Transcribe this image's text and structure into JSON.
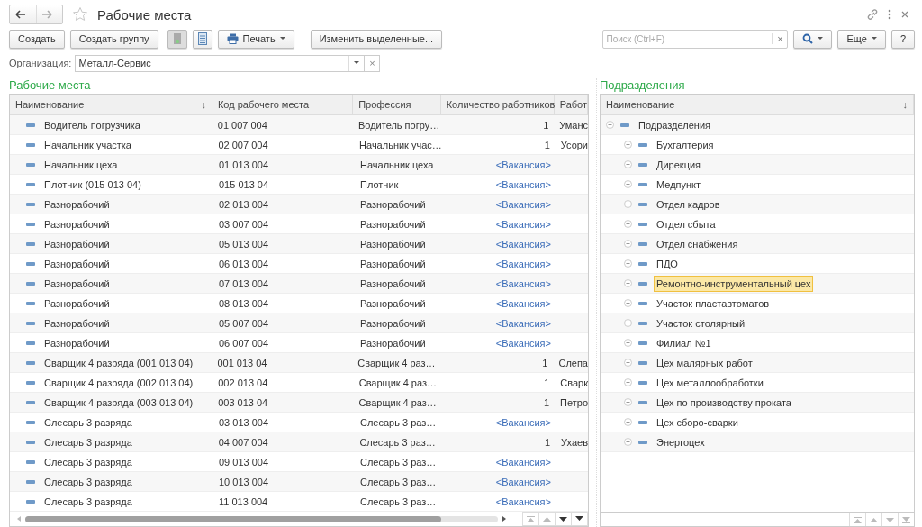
{
  "window": {
    "title": "Рабочие места",
    "favorite": false
  },
  "toolbar": {
    "buttons": [
      {
        "kind": "text",
        "label": "Создать"
      },
      {
        "kind": "text",
        "label": "Создать группу"
      },
      {
        "kind": "copy",
        "disabled": true
      },
      {
        "kind": "list",
        "disabled": false
      },
      {
        "kind": "print",
        "label": "Печать"
      },
      {
        "kind": "text",
        "label": "Изменить выделенные..."
      }
    ],
    "search": {
      "placeholder": "Поиск (Ctrl+F)",
      "clear": "×"
    },
    "more": "Еще",
    "help": "?"
  },
  "organization": {
    "label": "Организация:",
    "value": "Металл-Сервис",
    "clear": "×"
  },
  "workplaces": {
    "title": "Рабочие места",
    "columns": [
      {
        "label": "Наименование",
        "sort": "↓"
      },
      {
        "label": "Код рабочего места"
      },
      {
        "label": "Профессия"
      },
      {
        "label": "Количество работников"
      },
      {
        "label": "Работ"
      }
    ],
    "rows": [
      {
        "name": "Водитель погрузчика",
        "code": "01 007 004",
        "profession": "Водитель погру…",
        "workers": "1",
        "vacancy": false,
        "employee": "Уманс"
      },
      {
        "name": "Начальник участка",
        "code": "02 007 004",
        "profession": "Начальник учас…",
        "workers": "1",
        "vacancy": false,
        "employee": "Усори"
      },
      {
        "name": "Начальник цеха",
        "code": "01 013 004",
        "profession": "Начальник цеха",
        "workers": "<Вакансия>",
        "vacancy": true
      },
      {
        "name": "Плотник (015 013 04)",
        "code": "015 013 04",
        "profession": "Плотник",
        "workers": "<Вакансия>",
        "vacancy": true
      },
      {
        "name": "Разнорабочий",
        "code": "02 013 004",
        "profession": "Разнорабочий",
        "workers": "<Вакансия>",
        "vacancy": true
      },
      {
        "name": "Разнорабочий",
        "code": "03 007 004",
        "profession": "Разнорабочий",
        "workers": "<Вакансия>",
        "vacancy": true
      },
      {
        "name": "Разнорабочий",
        "code": "05 013 004",
        "profession": "Разнорабочий",
        "workers": "<Вакансия>",
        "vacancy": true
      },
      {
        "name": "Разнорабочий",
        "code": "06 013 004",
        "profession": "Разнорабочий",
        "workers": "<Вакансия>",
        "vacancy": true
      },
      {
        "name": "Разнорабочий",
        "code": "07 013 004",
        "profession": "Разнорабочий",
        "workers": "<Вакансия>",
        "vacancy": true
      },
      {
        "name": "Разнорабочий",
        "code": "08 013 004",
        "profession": "Разнорабочий",
        "workers": "<Вакансия>",
        "vacancy": true
      },
      {
        "name": "Разнорабочий",
        "code": "05 007 004",
        "profession": "Разнорабочий",
        "workers": "<Вакансия>",
        "vacancy": true
      },
      {
        "name": "Разнорабочий",
        "code": "06 007 004",
        "profession": "Разнорабочий",
        "workers": "<Вакансия>",
        "vacancy": true
      },
      {
        "name": "Сварщик 4 разряда (001 013 04)",
        "code": "001 013 04",
        "profession": "Сварщик 4 раз…",
        "workers": "1",
        "vacancy": false,
        "employee": "Слепа"
      },
      {
        "name": "Сварщик 4 разряда (002 013 04)",
        "code": "002 013 04",
        "profession": "Сварщик 4 раз…",
        "workers": "1",
        "vacancy": false,
        "employee": "Сварк"
      },
      {
        "name": "Сварщик 4 разряда (003 013 04)",
        "code": "003 013 04",
        "profession": "Сварщик 4 раз…",
        "workers": "1",
        "vacancy": false,
        "employee": "Петро"
      },
      {
        "name": "Слесарь 3 разряда",
        "code": "03 013 004",
        "profession": "Слесарь 3 раз…",
        "workers": "<Вакансия>",
        "vacancy": true
      },
      {
        "name": "Слесарь 3 разряда",
        "code": "04 007 004",
        "profession": "Слесарь 3 раз…",
        "workers": "1",
        "vacancy": false,
        "employee": "Ухаев"
      },
      {
        "name": "Слесарь 3 разряда",
        "code": "09 013 004",
        "profession": "Слесарь 3 раз…",
        "workers": "<Вакансия>",
        "vacancy": true
      },
      {
        "name": "Слесарь 3 разряда",
        "code": "10 013 004",
        "profession": "Слесарь 3 раз…",
        "workers": "<Вакансия>",
        "vacancy": true
      },
      {
        "name": "Слесарь 3 разряда",
        "code": "11 013 004",
        "profession": "Слесарь 3 раз…",
        "workers": "<Вакансия>",
        "vacancy": true
      }
    ]
  },
  "departments": {
    "title": "Подразделения",
    "column": {
      "label": "Наименование",
      "sort": "↓"
    },
    "tree": [
      {
        "label": "Подразделения",
        "expanded": true,
        "selected": false,
        "children": [
          {
            "label": "Бухгалтерия",
            "expanded": false,
            "selected": false
          },
          {
            "label": "Дирекция",
            "expanded": false,
            "selected": false
          },
          {
            "label": "Медпункт",
            "expanded": false,
            "selected": false
          },
          {
            "label": "Отдел кадров",
            "expanded": false,
            "selected": false
          },
          {
            "label": "Отдел сбыта",
            "expanded": false,
            "selected": false
          },
          {
            "label": "Отдел снабжения",
            "expanded": false,
            "selected": false
          },
          {
            "label": "ПДО",
            "expanded": false,
            "selected": false
          },
          {
            "label": "Ремонтно-инструментальный цех",
            "expanded": false,
            "selected": true
          },
          {
            "label": "Участок пластавтоматов",
            "expanded": false,
            "selected": false
          },
          {
            "label": "Участок столярный",
            "expanded": false,
            "selected": false
          },
          {
            "label": "Филиал №1",
            "expanded": false,
            "selected": false
          },
          {
            "label": "Цех малярных работ",
            "expanded": false,
            "selected": false
          },
          {
            "label": "Цех металлообработки",
            "expanded": false,
            "selected": false
          },
          {
            "label": "Цех по производству проката",
            "expanded": false,
            "selected": false
          },
          {
            "label": "Цех сборо-сварки",
            "expanded": false,
            "selected": false
          },
          {
            "label": "Энергоцех",
            "expanded": false,
            "selected": false
          }
        ]
      }
    ]
  }
}
